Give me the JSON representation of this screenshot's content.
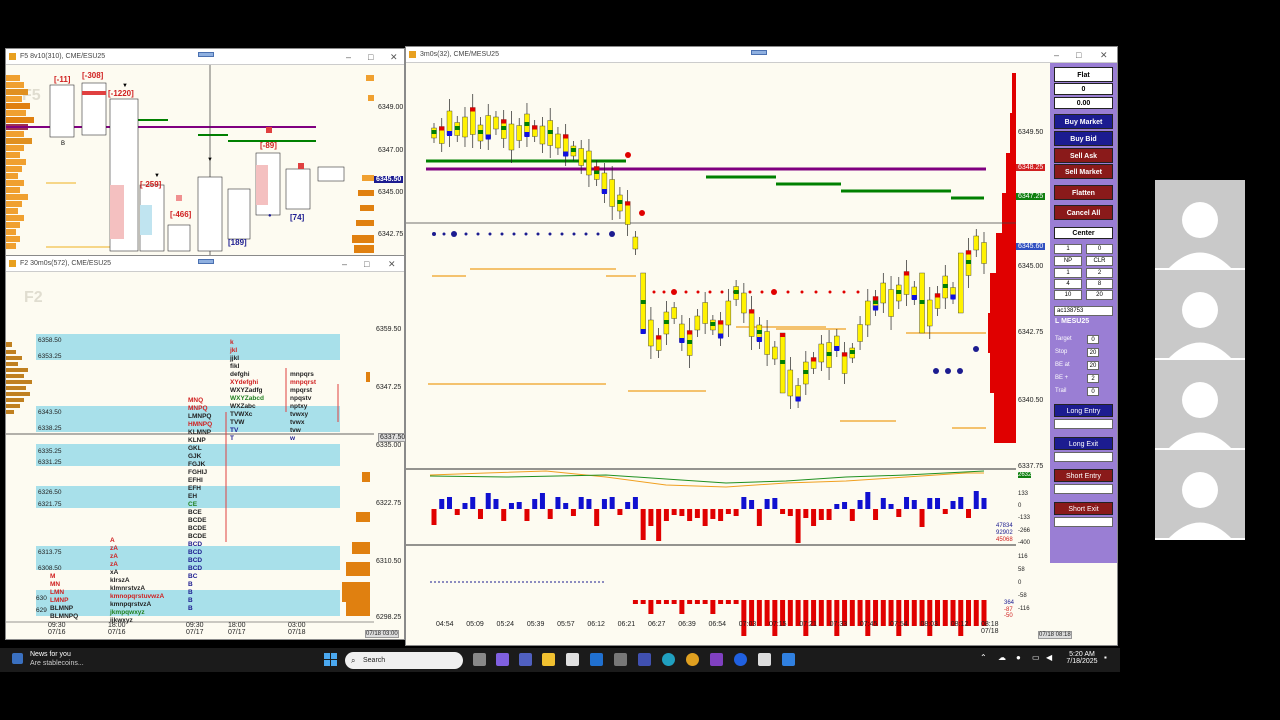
{
  "windows": {
    "top_left": {
      "title": "F5 8v10(310), CME/ESU25",
      "watermark": "F5",
      "prices": [
        "6349.00",
        "6347.00",
        "6345.00",
        "6342.75"
      ],
      "current_price": "6345.50",
      "annotations": [
        "[-11]",
        "[-308]",
        "[-1220]",
        "[-259]",
        "[-466]",
        "[-89]",
        "[189]",
        "[74]"
      ]
    },
    "bottom_left": {
      "title": "F2 30m0s(572), CME/ESU25",
      "watermark": "F2",
      "levels": [
        "6358.50",
        "6353.25",
        "6343.50",
        "6338.25",
        "6335.25",
        "6331.25",
        "6326.50",
        "6321.75",
        "6313.75",
        "6308.50",
        "630",
        "629"
      ],
      "prices": [
        "6359.50",
        "6347.25",
        "6335.00",
        "6322.75",
        "6310.50",
        "6298.25"
      ],
      "current_price": "6337.50",
      "time_labels": [
        "09:30\n07/16",
        "18:00\n07/16",
        "09:30\n07/17",
        "18:00\n07/17",
        "03:00\n07/18"
      ],
      "footer_time": "07/18 03:00"
    },
    "main": {
      "title": "3m0s(32), CME/MESU25",
      "prices": [
        "6349.50",
        "6347.25",
        "6345.00",
        "6342.75",
        "6340.50",
        "6337.75"
      ],
      "tags": [
        "6348.25",
        "6347.25",
        "6345.60"
      ],
      "time_labels": [
        "04:54",
        "05:09",
        "05:24",
        "05:39",
        "05:57",
        "06:12",
        "06:21",
        "06:27",
        "06:39",
        "06:54",
        "07:03",
        "07:15",
        "07:21",
        "07:33",
        "07:45",
        "07:54",
        "08:03",
        "08:12",
        "08:18\n07/18"
      ],
      "indicator1_labels": [
        "2632",
        "133",
        "0",
        "-133",
        "-266",
        "-400"
      ],
      "indicator1_values": [
        "47834",
        "92902",
        "45068"
      ],
      "indicator2_labels": [
        "116",
        "58",
        "0",
        "-58",
        "-116"
      ],
      "indicator2_values": [
        "364",
        "-87",
        "-50"
      ],
      "footer_time": "07/18 08:18"
    }
  },
  "order_panel": {
    "position": "Flat",
    "qty": "0",
    "pnl": "0.00",
    "buy_market": "Buy Market",
    "buy_bid": "Buy Bid",
    "sell_ask": "Sell Ask",
    "sell_market": "Sell Market",
    "flatten": "Flatten",
    "cancel_all": "Cancel All",
    "center": "Center",
    "qty_input": "1",
    "qty_right": "0",
    "np": "NP",
    "clr": "CLR",
    "grid": [
      "1",
      "2",
      "4",
      "8",
      "10",
      "20"
    ],
    "account": "ac138753",
    "symbol": "L MESU25",
    "target_label": "Target",
    "target_val": "0",
    "stop_label": "Stop",
    "stop_val": "20",
    "be_at_label": "BE at",
    "be_at_val": "20",
    "be_plus_label": "BE +",
    "be_plus_val": "2",
    "trail_label": "Trail",
    "trail_val": "0",
    "long_entry": "Long Entry",
    "long_exit": "Long Exit",
    "short_entry": "Short Entry",
    "short_exit": "Short Exit"
  },
  "taskbar": {
    "news_title": "News for you",
    "news_sub": "Are stablecoins...",
    "search_placeholder": "Search",
    "time": "5:20 AM",
    "date": "7/18/2025"
  },
  "colors": {
    "accent": "#1c1c90",
    "sell": "#8a1a1a",
    "panel": "#9a7ed4",
    "value_area": "#a8e0ea"
  }
}
